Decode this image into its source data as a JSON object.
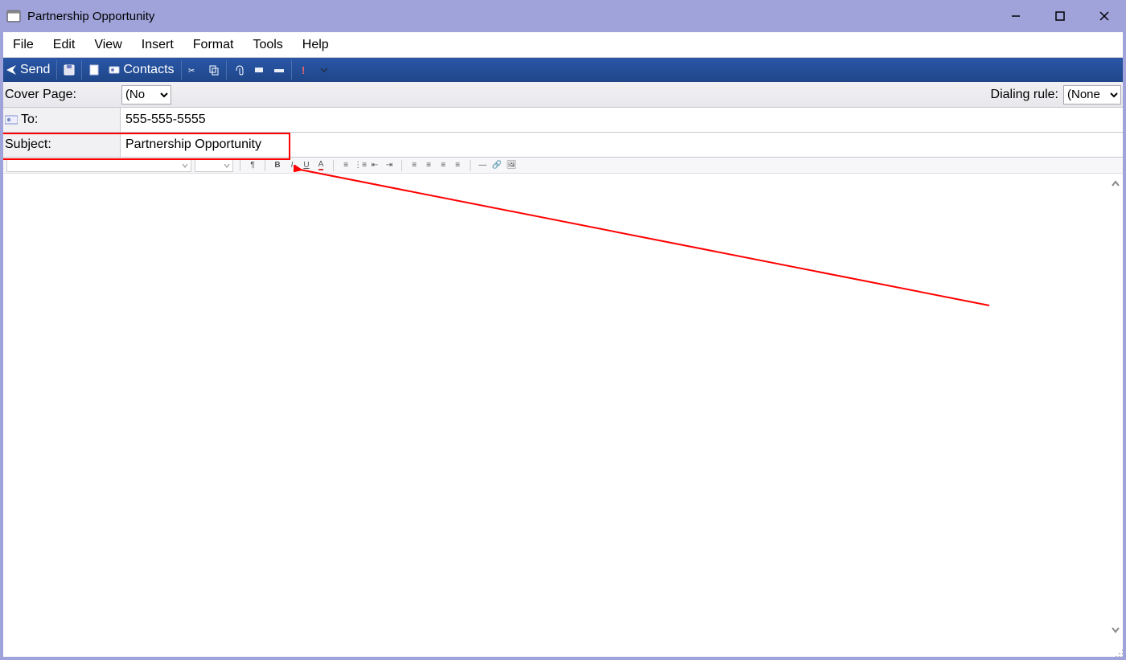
{
  "window": {
    "title": "Partnership Opportunity"
  },
  "menu": {
    "items": [
      "File",
      "Edit",
      "View",
      "Insert",
      "Format",
      "Tools",
      "Help"
    ]
  },
  "toolbar": {
    "send_label": "Send",
    "contacts_label": "Contacts"
  },
  "options": {
    "cover_page_label": "Cover Page:",
    "cover_page_value": "(No",
    "dialing_rule_label": "Dialing rule:",
    "dialing_rule_value": "(None"
  },
  "to": {
    "label": "To:",
    "value": "555-555-5555"
  },
  "subject": {
    "label": "Subject:",
    "value": "Partnership Opportunity"
  }
}
